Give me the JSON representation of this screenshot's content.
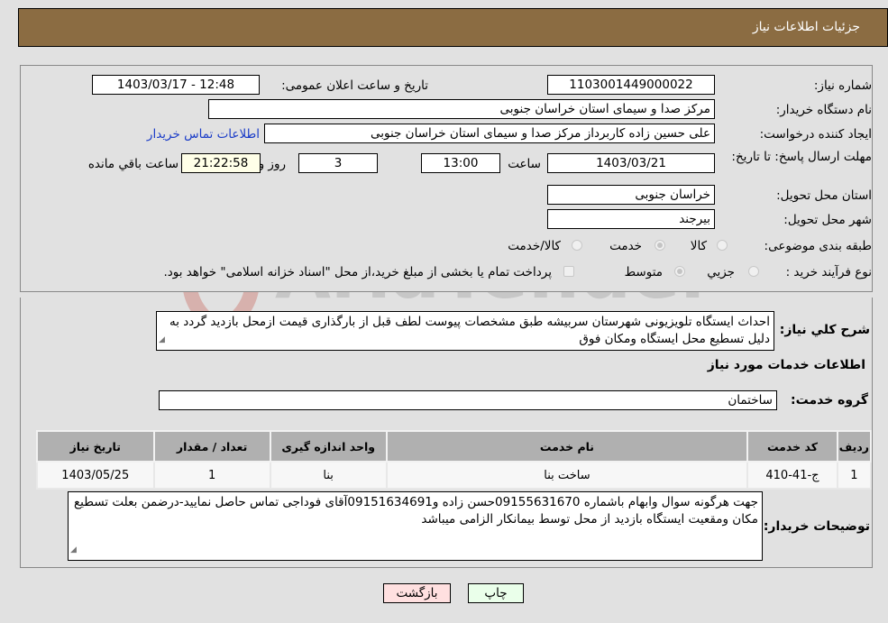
{
  "header": {
    "title": "جزئیات اطلاعات نیاز"
  },
  "fields": {
    "need_number_label": "شماره نیاز:",
    "need_number": "1103001449000022",
    "announce_label": "تاریخ و ساعت اعلان عمومی:",
    "announce_value": "1403/03/17 - 12:48",
    "buyer_org_label": "نام دستگاه خریدار:",
    "buyer_org": "مرکز صدا و سیمای استان خراسان جنوبی",
    "creator_label": "ایجاد کننده درخواست:",
    "creator": "علی حسین زاده کاربرداز مرکز صدا و سیمای استان خراسان جنوبی",
    "contact_link": "اطلاعات تماس خریدار",
    "deadline_label": "مهلت ارسال پاسخ: تا تاریخ:",
    "deadline_date": "1403/03/21",
    "time_label": "ساعت",
    "deadline_time": "13:00",
    "days_value": "3",
    "days_label": "روز و",
    "remaining_value": "21:22:58",
    "remaining_label": "ساعت باقي مانده",
    "province_label": "استان محل تحویل:",
    "province": "خراسان جنوبی",
    "city_label": "شهر محل تحویل:",
    "city": "بیرجند",
    "category_label": "طبقه بندی موضوعی:",
    "category_options": [
      "کالا",
      "خدمت",
      "کالا/خدمت"
    ],
    "category_selected": "خدمت",
    "process_label": "نوع فرآیند خرید :",
    "process_options": [
      "جزيي",
      "متوسط"
    ],
    "process_selected": "متوسط",
    "treasury_note": "پرداخت تمام یا بخشی از مبلغ خرید،از محل \"اسناد خزانه اسلامی\" خواهد بود."
  },
  "description": {
    "label": "شرح كلي نياز:",
    "text": "احداث ایستگاه تلویزیونی شهرستان سربیشه طبق مشخصات پیوست لطف قبل از بارگذاری قیمت ازمحل بازدید گردد به دلیل تسطیع محل ایستگاه ومکان فوق"
  },
  "services": {
    "section_title": "اطلاعات خدمات مورد نياز",
    "group_label": "گروه خدمت:",
    "group_value": "ساختمان",
    "columns": [
      "ردیف",
      "کد خدمت",
      "نام خدمت",
      "واحد اندازه گیری",
      "تعداد / مقدار",
      "تاریخ نیاز"
    ],
    "rows": [
      [
        "1",
        "ج-41-410",
        "ساخت بنا",
        "بنا",
        "1",
        "1403/05/25"
      ]
    ]
  },
  "buyer_notes": {
    "label": "توضيحات خريدار:",
    "text": "جهت هرگونه سوال وابهام باشماره 09155631670حسن زاده و09151634691آقای فوداجی تماس حاصل نمایید-درضمن بعلت تسطیع مکان ومقعیت ایستگاه بازدید از محل توسط بیمانکار الزامی میباشد"
  },
  "buttons": {
    "print": "چاپ",
    "back": "بازگشت"
  },
  "colors": {
    "header_bg": "#8b6c42",
    "print_bg": "#eaffea",
    "back_bg": "#ffe0e0",
    "link": "#1a3cc8"
  }
}
